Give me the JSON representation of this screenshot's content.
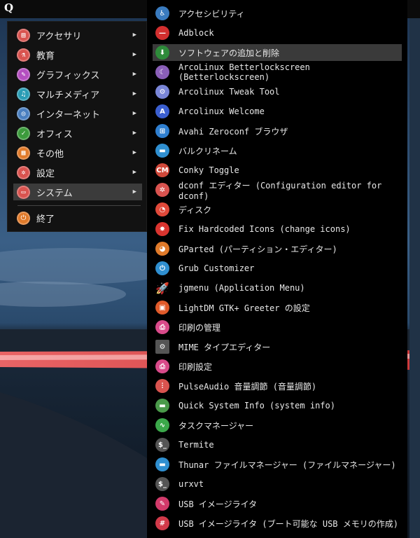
{
  "topbar": {
    "logo": "Q"
  },
  "main_menu": {
    "items": [
      {
        "label": "アクセサリ",
        "icon": "accessories-icon",
        "glyph": "▤",
        "color": "#d9534f",
        "submenu": true,
        "active": false
      },
      {
        "label": "教育",
        "icon": "education-icon",
        "glyph": "⚗",
        "color": "#d9534f",
        "submenu": true,
        "active": false
      },
      {
        "label": "グラフィックス",
        "icon": "graphics-icon",
        "glyph": "✎",
        "color": "#b44fc0",
        "submenu": true,
        "active": false
      },
      {
        "label": "マルチメディア",
        "icon": "multimedia-icon",
        "glyph": "♫",
        "color": "#2a9db5",
        "submenu": true,
        "active": false
      },
      {
        "label": "インターネット",
        "icon": "internet-icon",
        "glyph": "◎",
        "color": "#4a7fc0",
        "submenu": true,
        "active": false
      },
      {
        "label": "オフィス",
        "icon": "office-icon",
        "glyph": "✓",
        "color": "#3c9b3c",
        "submenu": true,
        "active": false
      },
      {
        "label": "その他",
        "icon": "other-icon",
        "glyph": "▦",
        "color": "#e07a2a",
        "submenu": true,
        "active": false
      },
      {
        "label": "設定",
        "icon": "settings-icon",
        "glyph": "✲",
        "color": "#d9534f",
        "submenu": true,
        "active": false
      },
      {
        "label": "システム",
        "icon": "system-icon",
        "glyph": "▭",
        "color": "#d9534f",
        "submenu": true,
        "active": true
      },
      {
        "label": "終了",
        "icon": "exit-icon",
        "glyph": "⏻",
        "color": "#e07a2a",
        "submenu": false,
        "active": false
      }
    ],
    "submenu_arrow": "▶"
  },
  "sub_menu": {
    "items": [
      {
        "label": "アクセシビリティ",
        "icon": "accessibility-icon",
        "glyph": "♿",
        "color": "#3a7bbf",
        "shape": "circle"
      },
      {
        "label": "Adblock",
        "icon": "adblock-icon",
        "glyph": "—",
        "color": "#d32f2f",
        "shape": "circle"
      },
      {
        "label": "ソフトウェアの追加と削除",
        "icon": "software-install-icon",
        "glyph": "⬇",
        "color": "#2e8b3a",
        "shape": "circle",
        "active": true
      },
      {
        "label": "ArcoLinux Betterlockscreen (Betterlockscreen)",
        "icon": "lockscreen-icon",
        "glyph": "☾",
        "color": "#8a5fb8",
        "shape": "circle"
      },
      {
        "label": "Arcolinux Tweak Tool",
        "icon": "tweak-tool-icon",
        "glyph": "⚙",
        "color": "#7a86d8",
        "shape": "circle"
      },
      {
        "label": "Arcolinux Welcome",
        "icon": "arcolinux-logo-icon",
        "glyph": "A",
        "color": "#3b5fd0",
        "shape": "circle"
      },
      {
        "label": "Avahi Zeroconf ブラウザ",
        "icon": "network-browser-icon",
        "glyph": "⊞",
        "color": "#2f7fd0",
        "shape": "circle"
      },
      {
        "label": "バルクリネーム",
        "icon": "bulk-rename-icon",
        "glyph": "▬",
        "color": "#2f8fd0",
        "shape": "circle"
      },
      {
        "label": "Conky Toggle",
        "icon": "conky-icon",
        "glyph": "CM",
        "color": "#d0483a",
        "shape": "circle"
      },
      {
        "label": "dconf エディター (Configuration editor for dconf)",
        "icon": "dconf-editor-icon",
        "glyph": "✲",
        "color": "#d9534f",
        "shape": "circle"
      },
      {
        "label": "ディスク",
        "icon": "disks-icon",
        "glyph": "◔",
        "color": "#e0493a",
        "shape": "circle"
      },
      {
        "label": "Fix Hardcoded Icons (change icons)",
        "icon": "fix-icons-icon",
        "glyph": "✸",
        "color": "#d9342f",
        "shape": "circle"
      },
      {
        "label": "GParted (パーティション・エディター)",
        "icon": "gparted-icon",
        "glyph": "◕",
        "color": "#e07a2a",
        "shape": "circle"
      },
      {
        "label": "Grub Customizer",
        "icon": "grub-customizer-icon",
        "glyph": "⏻",
        "color": "#2f8fd0",
        "shape": "circle"
      },
      {
        "label": "jgmenu (Application Menu)",
        "icon": "rocket-icon",
        "glyph": "🚀",
        "color": "#000000",
        "shape": "plain"
      },
      {
        "label": "LightDM GTK+ Greeter の設定",
        "icon": "lightdm-icon",
        "glyph": "▣",
        "color": "#e05a2a",
        "shape": "circle"
      },
      {
        "label": "印刷の管理",
        "icon": "printer-icon",
        "glyph": "⎙",
        "color": "#d94a8a",
        "shape": "circle"
      },
      {
        "label": "MIME タイプエディター",
        "icon": "mime-editor-icon",
        "glyph": "⚙",
        "color": "#555555",
        "shape": "square"
      },
      {
        "label": "印刷設定",
        "icon": "print-settings-icon",
        "glyph": "⎙",
        "color": "#d94a8a",
        "shape": "circle"
      },
      {
        "label": "PulseAudio 音量調節 (音量調節)",
        "icon": "volume-control-icon",
        "glyph": "⫶",
        "color": "#d9534f",
        "shape": "circle"
      },
      {
        "label": "Quick System Info (system info)",
        "icon": "system-info-icon",
        "glyph": "▬",
        "color": "#4a9a4a",
        "shape": "circle"
      },
      {
        "label": "タスクマネージャー",
        "icon": "task-manager-icon",
        "glyph": "∿",
        "color": "#3ba84a",
        "shape": "circle"
      },
      {
        "label": "Termite",
        "icon": "terminal-icon",
        "glyph": "$_",
        "color": "#555555",
        "shape": "circle"
      },
      {
        "label": "Thunar ファイルマネージャー (ファイルマネージャー)",
        "icon": "file-manager-icon",
        "glyph": "▬",
        "color": "#2f8fd0",
        "shape": "circle"
      },
      {
        "label": "urxvt",
        "icon": "urxvt-icon",
        "glyph": "$_",
        "color": "#555555",
        "shape": "circle"
      },
      {
        "label": "USB イメージライタ",
        "icon": "usb-writer-icon",
        "glyph": "✎",
        "color": "#d23a6a",
        "shape": "circle"
      },
      {
        "label": "USB イメージライタ (ブート可能な USB メモリの作成)",
        "icon": "usb-bootable-icon",
        "glyph": "#",
        "color": "#d23a4a",
        "shape": "circle"
      }
    ]
  }
}
